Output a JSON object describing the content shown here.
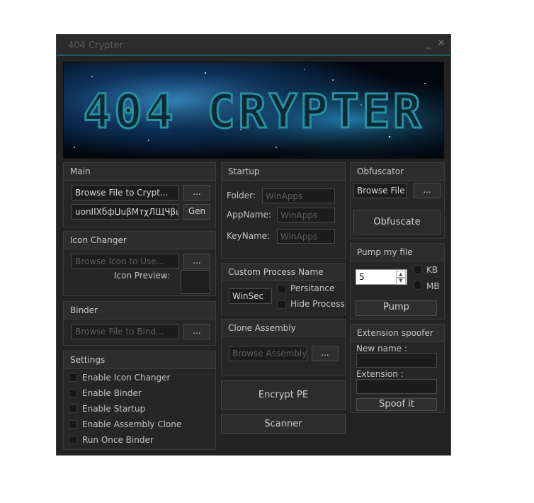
{
  "window": {
    "title": "404 Crypter",
    "minimize": "_",
    "close": "✕"
  },
  "main": {
    "title": "Main",
    "file_value": "Browse File to Crypt...",
    "browse_btn": "...",
    "key_value": "uonIIXбфЏuβMтχЛЩЧβшк",
    "gen_btn": "Gen"
  },
  "startup": {
    "title": "Startup",
    "folder_label": "Folder:",
    "folder_value": "WinApps",
    "appname_label": "AppName:",
    "appname_value": "WinApps",
    "keyname_label": "KeyName:",
    "keyname_value": "WinApps"
  },
  "obfuscator": {
    "title": "Obfuscator",
    "file_value": "Browse File",
    "browse_btn": "...",
    "obfuscate_btn": "Obfuscate"
  },
  "icon_changer": {
    "title": "Icon Changer",
    "icon_value": "Browse Icon to Use...",
    "browse_btn": "...",
    "preview_label": "Icon Preview:"
  },
  "custom_process": {
    "title": "Custom Process Name",
    "name_value": "WinSec",
    "persistance": "Persitance",
    "hide_process": "Hide Process"
  },
  "pump": {
    "title": "Pump my file",
    "value": "5",
    "kb": "KB",
    "mb": "MB",
    "pump_btn": "Pump"
  },
  "binder": {
    "title": "Binder",
    "file_value": "Browse File to Bind...",
    "browse_btn": "..."
  },
  "clone": {
    "title": "Clone Assembly",
    "assembly_value": "Browse Assembly",
    "browse_btn": "..."
  },
  "spoofer": {
    "title": "Extension spoofer",
    "new_name_label": "New name :",
    "extension_label": "Extension :",
    "spoof_btn": "Spoof it"
  },
  "settings": {
    "title": "Settings",
    "items": [
      {
        "label": "Enable Icon Changer"
      },
      {
        "label": "Enable Binder"
      },
      {
        "label": "Enable Startup"
      },
      {
        "label": "Enable Assembly Clone"
      },
      {
        "label": "Run Once Binder"
      }
    ]
  },
  "actions": {
    "encrypt_btn": "Encrypt PE",
    "scanner_btn": "Scanner"
  },
  "banner": {
    "logo_text": "404 CRYPTER"
  },
  "colors": {
    "accent": "#1c5c6c",
    "background": "#232323",
    "panel": "#262626",
    "logo": "#2a8fa0"
  }
}
